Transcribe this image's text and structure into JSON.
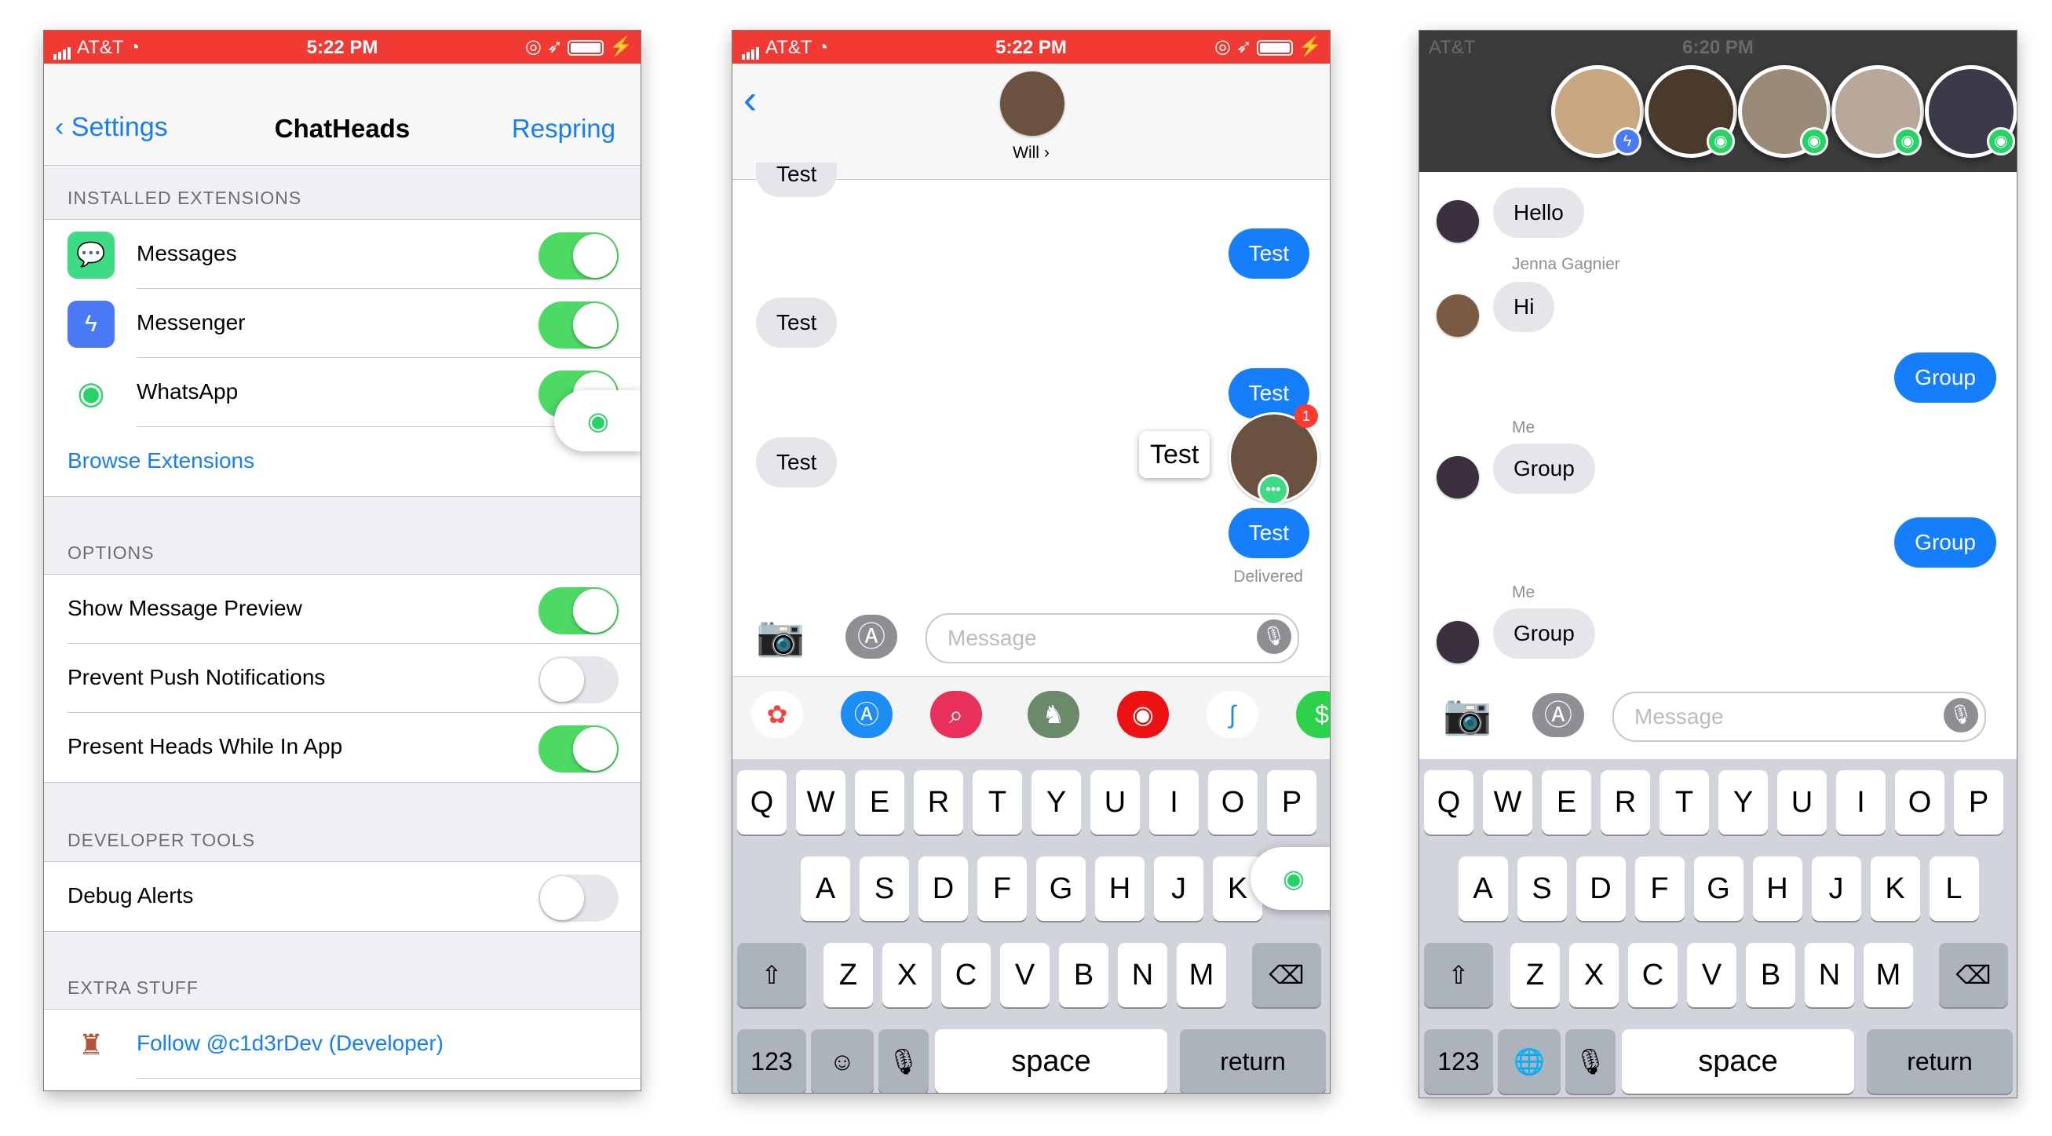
{
  "screen1": {
    "status": {
      "carrier": "AT&T",
      "time": "5:22 PM"
    },
    "nav": {
      "back": "Settings",
      "title": "ChatHeads",
      "action": "Respring"
    },
    "installed": {
      "header": "INSTALLED EXTENSIONS",
      "items": [
        {
          "label": "Messages",
          "icon": "messages-icon",
          "on": true
        },
        {
          "label": "Messenger",
          "icon": "messenger-icon",
          "on": true
        },
        {
          "label": "WhatsApp",
          "icon": "whatsapp-icon",
          "on": true
        }
      ],
      "browse": "Browse Extensions"
    },
    "options": {
      "header": "OPTIONS",
      "items": [
        {
          "label": "Show Message Preview",
          "on": true
        },
        {
          "label": "Prevent Push Notifications",
          "on": false
        },
        {
          "label": "Present Heads While In App",
          "on": true
        }
      ]
    },
    "dev": {
      "header": "DEVELOPER TOOLS",
      "items": [
        {
          "label": "Debug Alerts",
          "on": false
        }
      ]
    },
    "extra": {
      "header": "EXTRA STUFF",
      "items": [
        {
          "label": "Follow @c1d3rDev (Developer)"
        }
      ]
    }
  },
  "screen2": {
    "status": {
      "carrier": "AT&T",
      "time": "5:22 PM"
    },
    "contact": "Will",
    "messages": [
      "Test",
      "Test",
      "Test",
      "Test",
      "Test",
      "Test",
      "Test"
    ],
    "preview": "Test",
    "badge": "1",
    "delivered": "Delivered",
    "placeholder": "Message",
    "keys": {
      "row1": [
        "Q",
        "W",
        "E",
        "R",
        "T",
        "Y",
        "U",
        "I",
        "O",
        "P"
      ],
      "row2": [
        "A",
        "S",
        "D",
        "F",
        "G",
        "H",
        "J",
        "K"
      ],
      "row3": [
        "Z",
        "X",
        "C",
        "V",
        "B",
        "N",
        "M"
      ],
      "num": "123",
      "space": "space",
      "ret": "return"
    }
  },
  "screen3": {
    "status": {
      "carrier": "AT&T",
      "time": "6:20 PM"
    },
    "messages": {
      "hello": "Hello",
      "jenna": "Jenna Gagnier",
      "hi": "Hi",
      "group": "Group",
      "me": "Me"
    },
    "placeholder": "Message",
    "keys": {
      "row1": [
        "Q",
        "W",
        "E",
        "R",
        "T",
        "Y",
        "U",
        "I",
        "O",
        "P"
      ],
      "row2": [
        "A",
        "S",
        "D",
        "F",
        "G",
        "H",
        "J",
        "K",
        "L"
      ],
      "row3": [
        "Z",
        "X",
        "C",
        "V",
        "B",
        "N",
        "M"
      ],
      "num": "123",
      "space": "space",
      "ret": "return"
    }
  },
  "colors": {
    "ios_blue": "#147efb",
    "status_red": "#f13a34",
    "toggle_on": "#4cd964",
    "whatsapp": "#25d366",
    "messenger": "#4a7af5",
    "messages": "#3ddc84"
  }
}
